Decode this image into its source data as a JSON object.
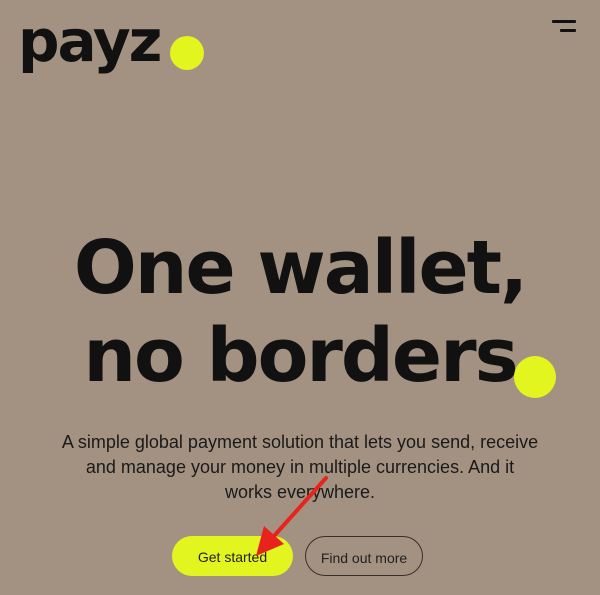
{
  "brand": {
    "logo_text": "payz",
    "accent_color": "#e2f51e"
  },
  "header": {
    "menu_icon": "menu-icon"
  },
  "hero": {
    "headline_line1": "One wallet,",
    "headline_line2": "no borders",
    "subtitle": "A simple global payment solution that lets you send, receive and manage your money in multiple currencies. And it works everywhere.",
    "primary_cta": "Get started",
    "secondary_cta": "Find out more"
  },
  "annotation": {
    "arrow_color": "#e8231e",
    "arrow_icon": "red-arrow-icon"
  }
}
